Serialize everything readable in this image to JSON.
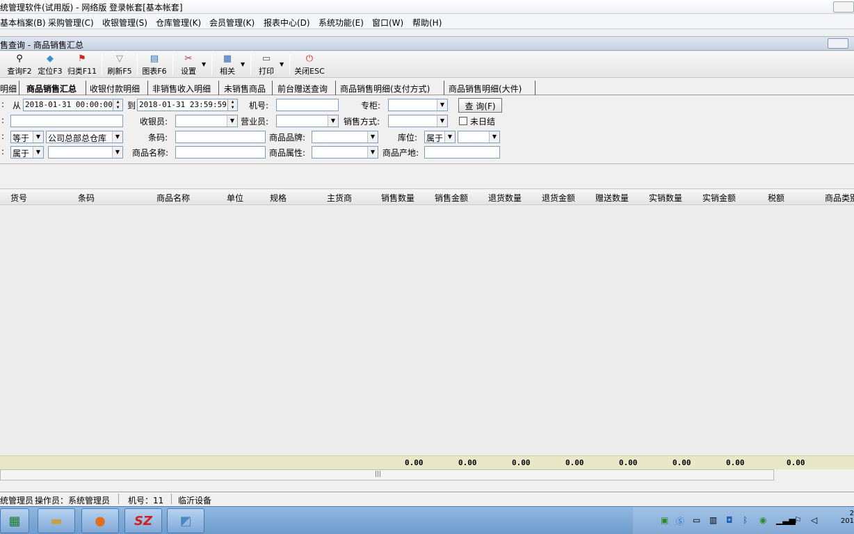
{
  "window": {
    "title": "统管理软件(试用版) - 网络版  登录帐套[基本帐套]"
  },
  "menu": [
    "基本档案(B)",
    "采购管理(C)",
    "收银管理(S)",
    "仓库管理(K)",
    "会员管理(K)",
    "报表中心(D)",
    "系统功能(E)",
    "窗口(W)",
    "帮助(H)"
  ],
  "child_window": {
    "title": "售查询 - 商品销售汇总"
  },
  "toolbar": {
    "query": "查询F2",
    "locate": "定位F3",
    "classify": "归类F11",
    "refresh": "刷新F5",
    "chart": "图表F6",
    "settings": "设置",
    "related": "相关",
    "print": "打印",
    "close": "关闭ESC"
  },
  "tabs": [
    "明细",
    "商品销售汇总",
    "收银付款明细",
    "非销售收入明细",
    "未销售商品",
    "前台赠送查询",
    "商品销售明细(支付方式)",
    "商品销售明细(大件)"
  ],
  "filters": {
    "from_label": "从",
    "from_value": "2018-01-31 00:00:00",
    "to_label": "到",
    "to_value": "2018-01-31 23:59:59",
    "machine_label": "机号:",
    "counter_label": "专柜:",
    "query_button": "查 询(F)",
    "cashier_label": "收银员:",
    "sales_person_label": "营业员:",
    "sale_mode_label": "销售方式:",
    "unsettled_label": "未日结",
    "warehouse_op": "等于",
    "warehouse_value": "公司总部总仓库",
    "barcode_label": "条码:",
    "brand_label": "商品品牌:",
    "location_label": "库位:",
    "location_op": "属于",
    "category_op": "属于",
    "name_label": "商品名称:",
    "attr_label": "商品属性:",
    "origin_label": "商品产地:"
  },
  "grid": {
    "columns": [
      "货号",
      "条码",
      "商品名称",
      "单位",
      "规格",
      "主货商",
      "销售数量",
      "销售金额",
      "退货数量",
      "退货金额",
      "赠送数量",
      "实销数量",
      "实销金额",
      "税额",
      "商品类别"
    ],
    "totals": [
      "0.00",
      "0.00",
      "0.00",
      "0.00",
      "0.00",
      "0.00",
      "0.00",
      "0.00"
    ]
  },
  "status": {
    "user": "统管理员",
    "operator": "操作员：系统管理员",
    "machine": "机号：11",
    "device": "临沂设备"
  },
  "taskbar": {
    "clock_line1": "2",
    "clock_line2": "201"
  }
}
